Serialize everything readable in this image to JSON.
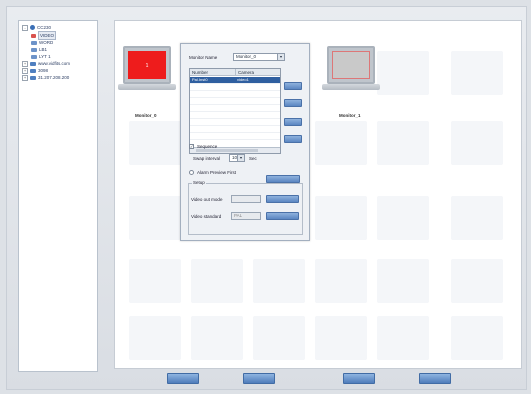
{
  "tree": {
    "root_label": "CC230",
    "items": [
      {
        "label": "VIDEO",
        "selected": true
      },
      {
        "label": "WORD"
      },
      {
        "label": "LB1"
      },
      {
        "label": "LYT 1"
      },
      {
        "label": "www.vidfits.com"
      },
      {
        "label": "3098"
      },
      {
        "label": "31.207.208.200"
      }
    ]
  },
  "monitors": [
    {
      "label": "Monitor_0",
      "screen_color": "#ee1c1c",
      "screen_text": "1"
    },
    {
      "label": "Monitor_1",
      "screen_color": "#c9c9c9",
      "screen_text": ""
    }
  ],
  "popup": {
    "monitor_name_label": "Monitor Name",
    "monitor_name_value": "Monitor_0",
    "table": {
      "columns": [
        "Number",
        "Camera"
      ],
      "rows": [
        {
          "number": "Pal.Inst0",
          "camera": "video1"
        }
      ]
    },
    "sequence_label": "Sequence",
    "sequence_checked": true,
    "swap_interval_label": "Swap interval",
    "swap_interval_value": "10",
    "swap_interval_unit": "Sec",
    "alarm_preview_label": "Alarm Preview First",
    "setup_label": "Setup",
    "video_out_mode_label": "Video out mode",
    "video_standard_label": "Video standard",
    "video_standard_value": "PAL"
  },
  "colors": {
    "accent": "#4f7dbb",
    "selection": "#2f5fa0"
  }
}
